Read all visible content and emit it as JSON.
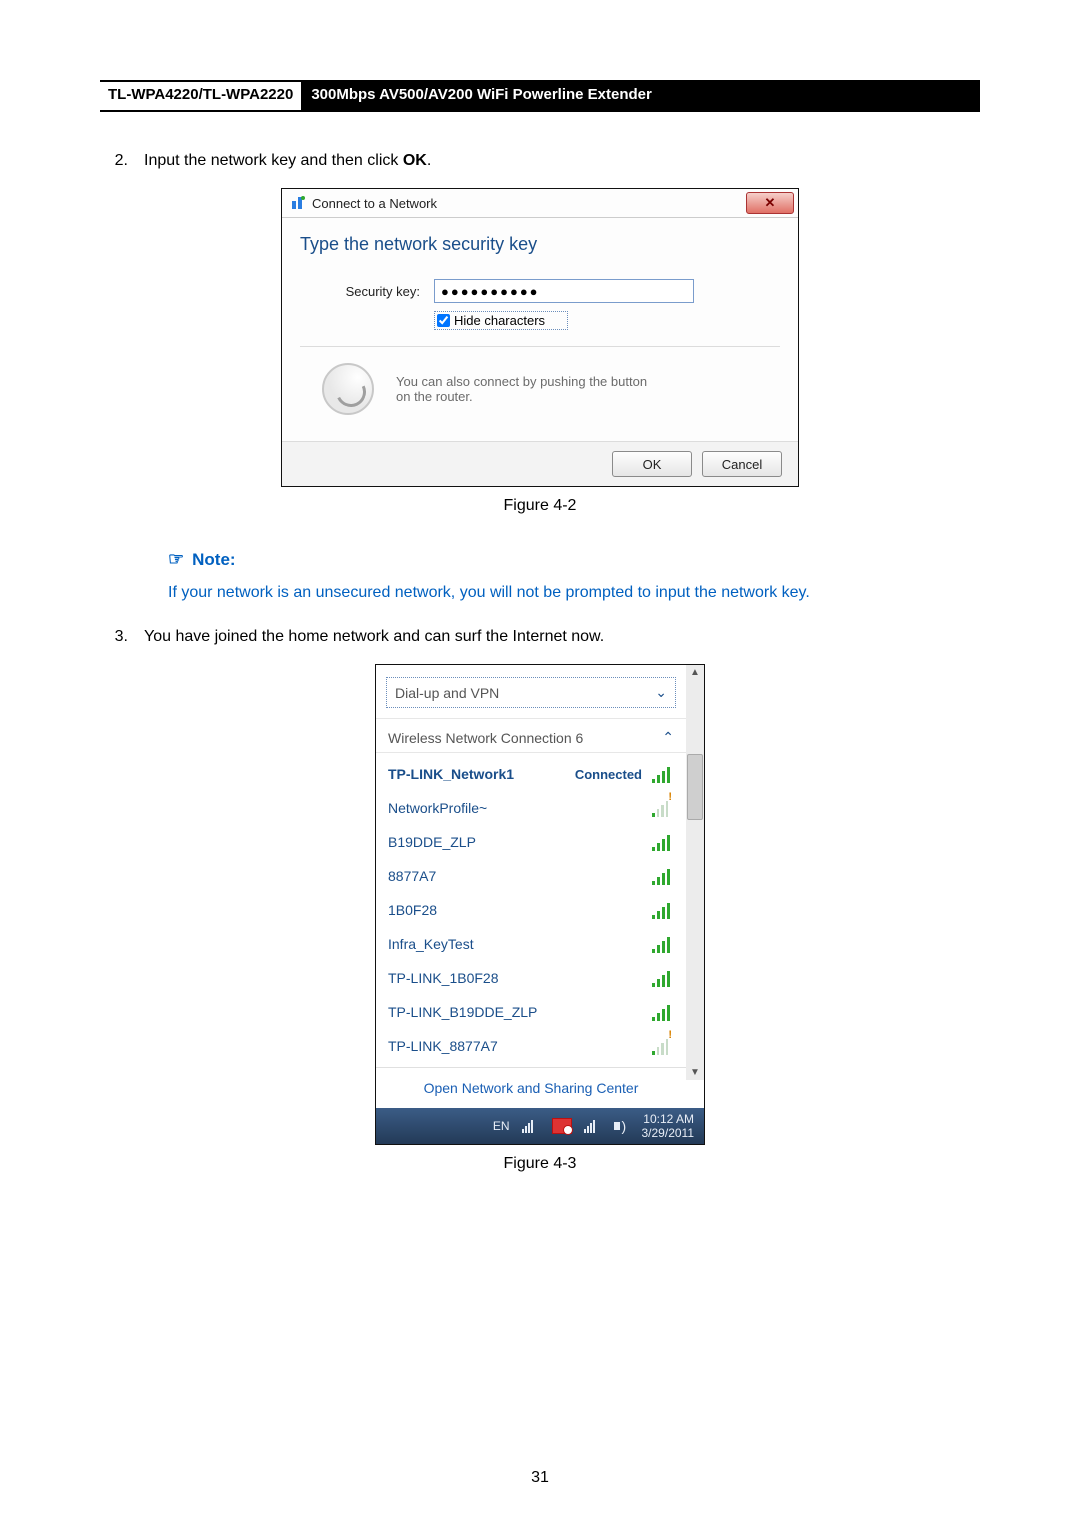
{
  "header": {
    "model": "TL-WPA4220/TL-WPA2220",
    "product": "300Mbps AV500/AV200 WiFi Powerline Extender"
  },
  "step2": {
    "num": "2.",
    "pre": "Input the network key and then click ",
    "bold": "OK",
    "post": "."
  },
  "dialog": {
    "title": "Connect to a Network",
    "heading": "Type the network security key",
    "label": "Security key:",
    "value": "●●●●●●●●●●",
    "hide_label": "Hide characters",
    "hint": "You can also connect by pushing the button on the router.",
    "ok": "OK",
    "cancel": "Cancel"
  },
  "fig1": "Figure 4-2",
  "note": {
    "title": "Note:",
    "body": "If your network is an unsecured network, you will not be prompted to input the network key."
  },
  "step3": {
    "num": "3.",
    "text": "You have joined the home network and can surf the Internet now."
  },
  "fly": {
    "group": "Dial-up and VPN",
    "section": "Wireless Network Connection 6",
    "items": [
      {
        "name": "TP-LINK_Network1",
        "status": "Connected",
        "sig": "s4",
        "bold": true
      },
      {
        "name": "NetworkProfile~",
        "sig": "s1",
        "warn": true
      },
      {
        "name": "B19DDE_ZLP",
        "sig": "s4"
      },
      {
        "name": "8877A7",
        "sig": "s4"
      },
      {
        "name": "1B0F28",
        "sig": "s4"
      },
      {
        "name": "Infra_KeyTest",
        "sig": "s4"
      },
      {
        "name": "TP-LINK_1B0F28",
        "sig": "s4"
      },
      {
        "name": "TP-LINK_B19DDE_ZLP",
        "sig": "s4"
      },
      {
        "name": "TP-LINK_8877A7",
        "sig": "s1",
        "warn": true
      }
    ],
    "open": "Open Network and Sharing Center",
    "lang": "EN",
    "time": "10:12 AM",
    "date": "3/29/2011"
  },
  "fig2": "Figure 4-3",
  "page": "31"
}
